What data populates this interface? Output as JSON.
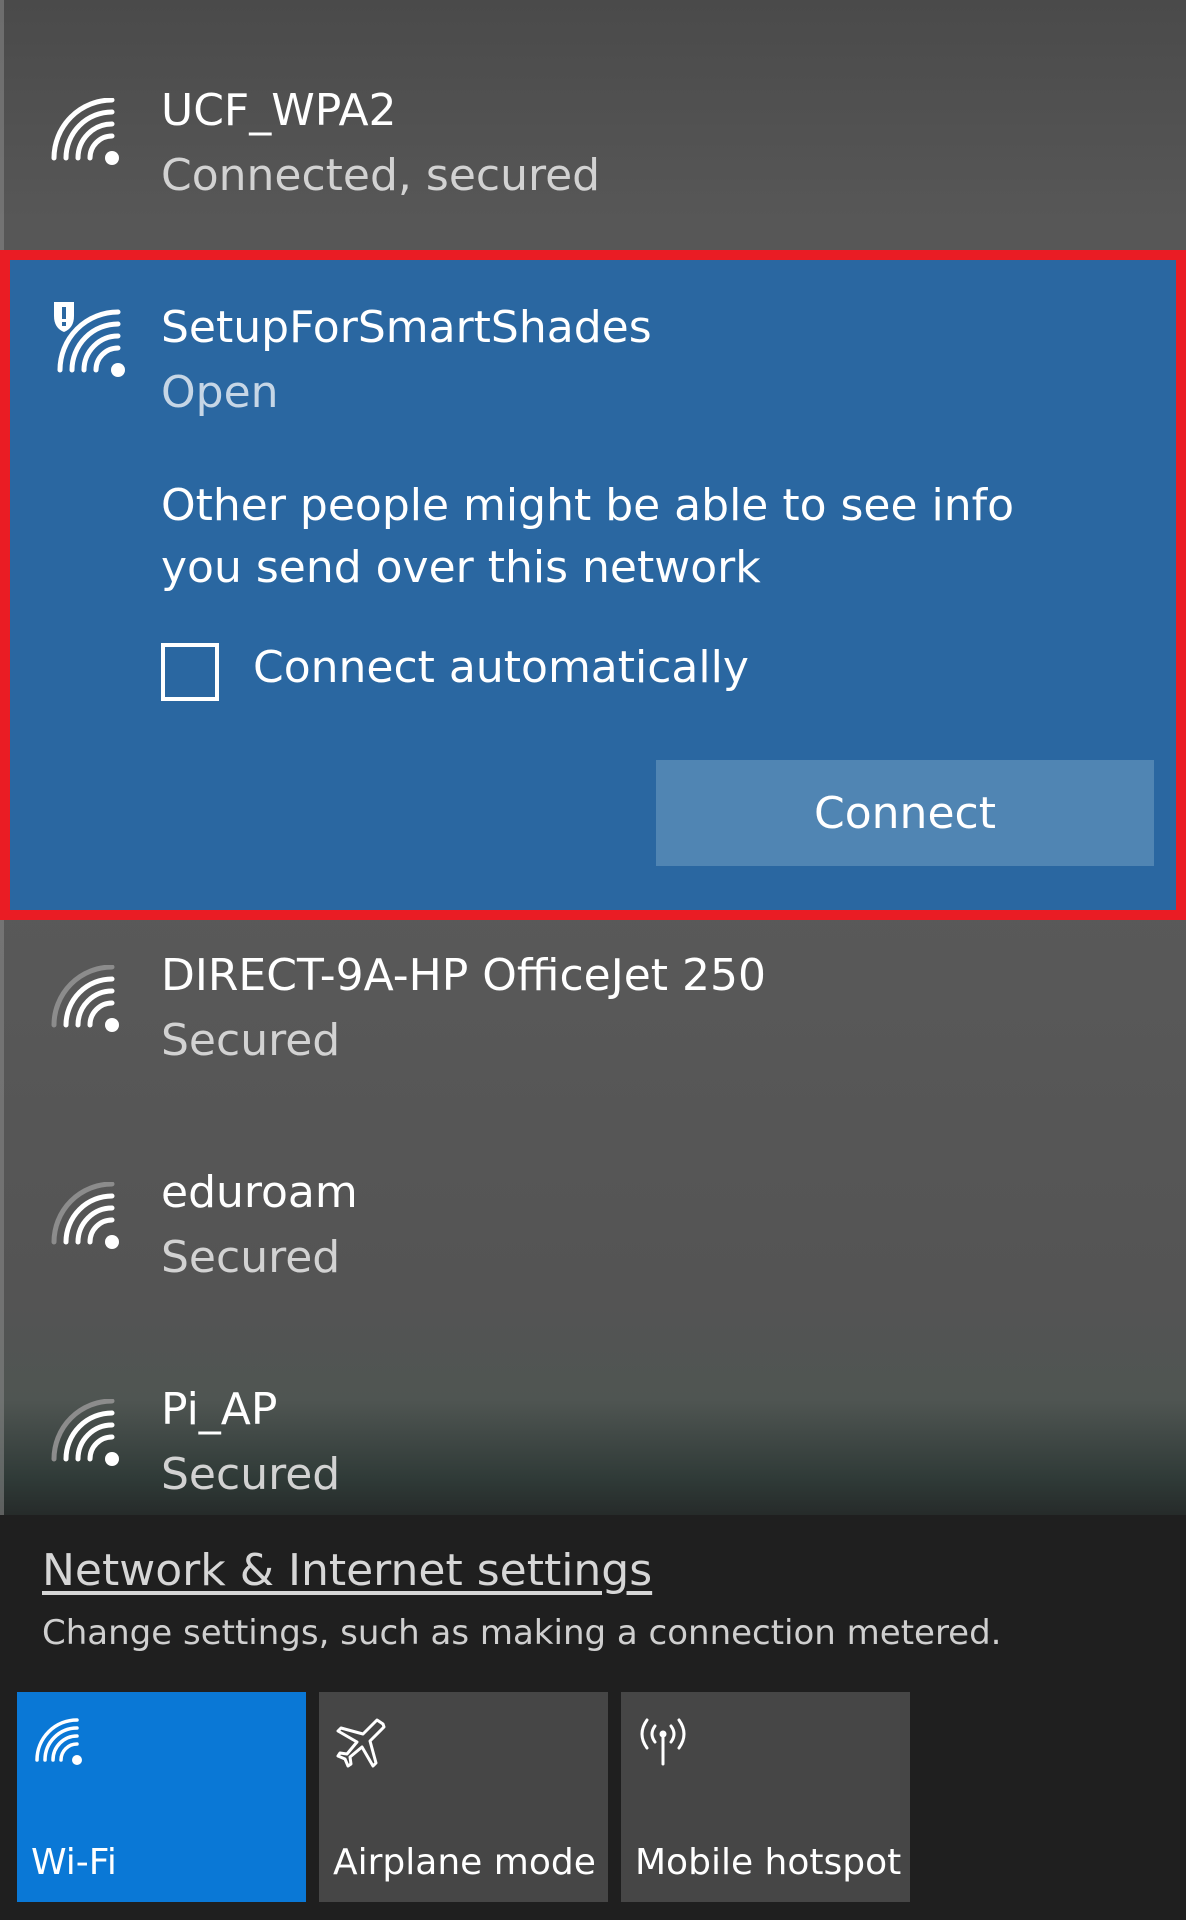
{
  "networks": [
    {
      "name": "UCF_WPA2",
      "status": "Connected, secured",
      "icon": "wifi-icon"
    },
    {
      "name": "SetupForSmartShades",
      "status": "Open",
      "icon": "wifi-warning-icon"
    },
    {
      "name": "DIRECT-9A-HP OfficeJet 250",
      "status": "Secured",
      "icon": "wifi-icon"
    },
    {
      "name": "eduroam",
      "status": "Secured",
      "icon": "wifi-icon"
    },
    {
      "name": "Pi_AP",
      "status": "Secured",
      "icon": "wifi-icon"
    }
  ],
  "selected": {
    "warning": "Other people might be able to see info you send over this network",
    "auto_connect_label": "Connect automatically",
    "auto_connect_checked": false,
    "connect_label": "Connect",
    "highlight_color": "#ea1c24"
  },
  "settings": {
    "link": "Network & Internet settings",
    "description": "Change settings, such as making a connection metered."
  },
  "tiles": [
    {
      "label": "Wi-Fi",
      "icon": "wifi-icon",
      "active": true
    },
    {
      "label": "Airplane mode",
      "icon": "airplane-icon",
      "active": false
    },
    {
      "label": "Mobile hotspot",
      "icon": "hotspot-icon",
      "active": false
    }
  ],
  "colors": {
    "accent": "#0a78d6",
    "selected_bg": "#2a67a1",
    "button_bg": "#5085b3"
  }
}
